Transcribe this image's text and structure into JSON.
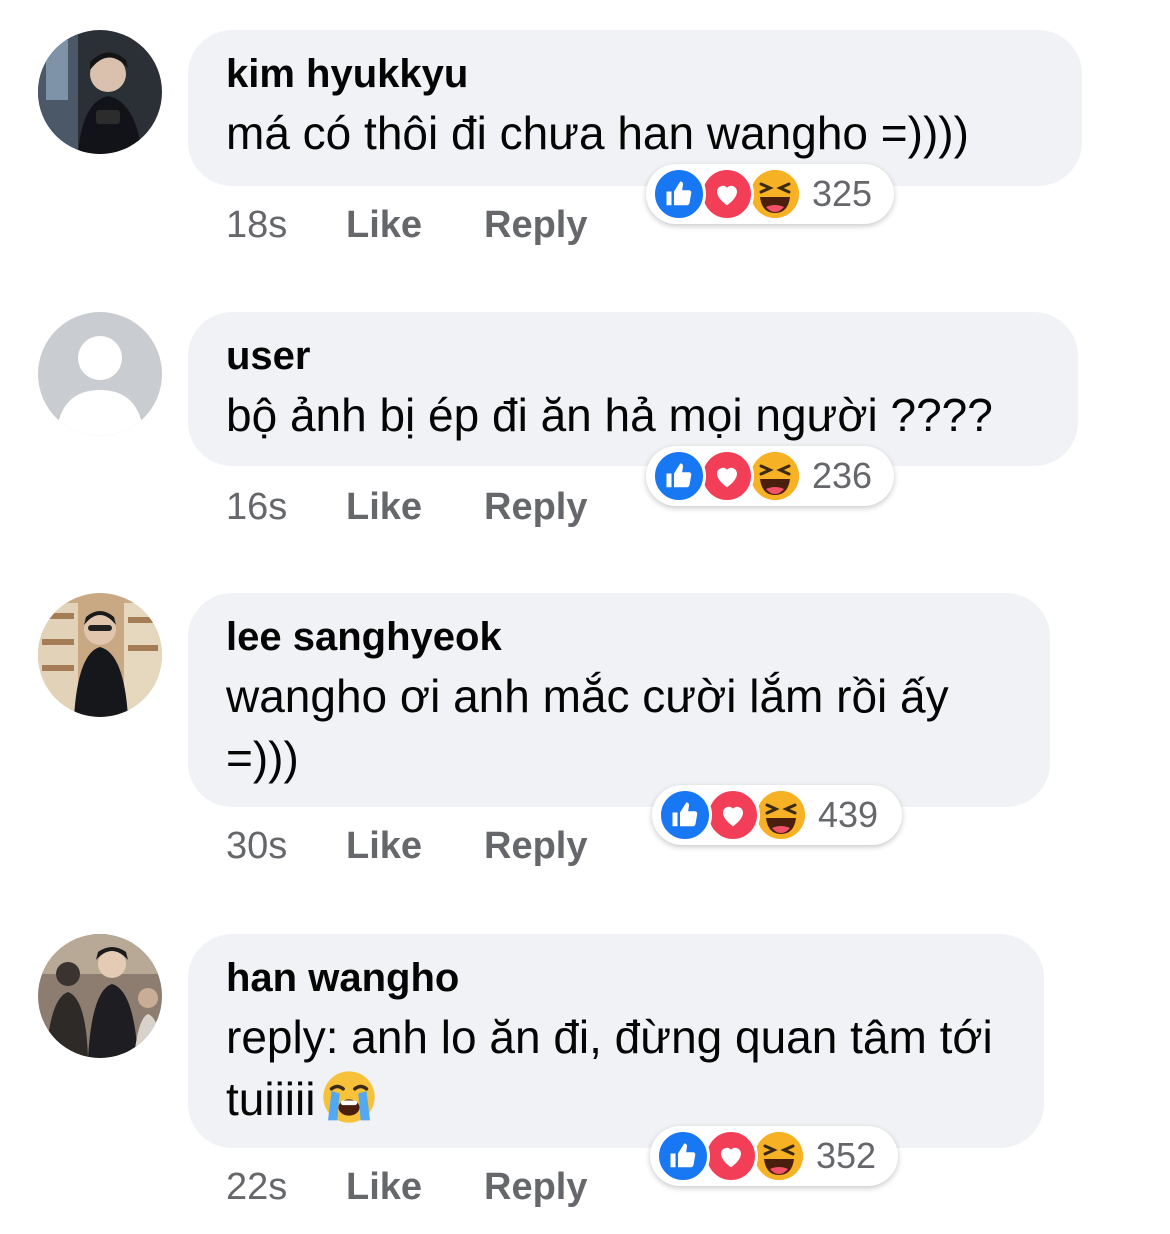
{
  "comments": [
    {
      "author": "kim hyukkyu",
      "text": "má có thôi đi chưa han wangho =))))",
      "time": "18s",
      "like_label": "Like",
      "reply_label": "Reply",
      "reaction_count": "325"
    },
    {
      "author": "user",
      "text": "bộ ảnh bị ép đi ăn hả mọi người ????",
      "time": "16s",
      "like_label": "Like",
      "reply_label": "Reply",
      "reaction_count": "236"
    },
    {
      "author": "lee sanghyeok",
      "text": "wangho ơi anh mắc cười lắm rồi ấy =)))",
      "time": "30s",
      "like_label": "Like",
      "reply_label": "Reply",
      "reaction_count": "439"
    },
    {
      "author": "han wangho",
      "text": "reply: anh lo ăn đi, đừng quan tâm tới tuiiiii",
      "time": "22s",
      "like_label": "Like",
      "reply_label": "Reply",
      "reaction_count": "352",
      "trailing_emoji": "loudly-crying-face-emoji"
    }
  ],
  "colors": {
    "bubble": "#f0f2f5",
    "meta_text": "#65676b",
    "like_reaction": "#1877f2",
    "love_reaction": "#f33e58",
    "haha_reaction": "#f7b125"
  },
  "reaction_icons": [
    "like-reaction-icon",
    "love-reaction-icon",
    "haha-reaction-icon"
  ]
}
